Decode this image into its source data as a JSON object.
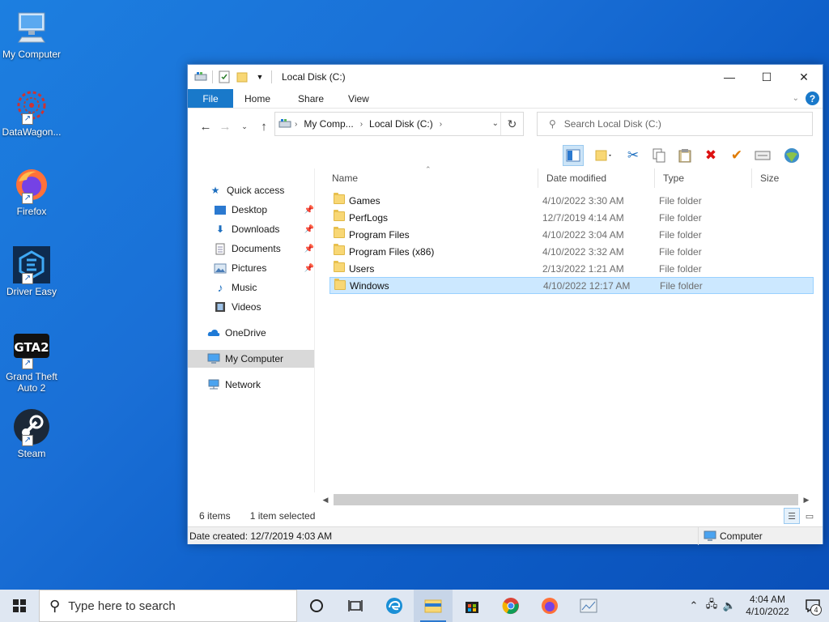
{
  "desktop": {
    "icons": [
      {
        "label": "My Computer"
      },
      {
        "label": "DataWagon..."
      },
      {
        "label": "Firefox"
      },
      {
        "label": "Driver Easy"
      },
      {
        "label": "Grand Theft Auto 2"
      },
      {
        "label": "Steam"
      }
    ],
    "gta_logo_text": "GTA2"
  },
  "window": {
    "title": "Local Disk (C:)",
    "controls": {
      "minimize": "—",
      "maximize": "☐",
      "close": "✕"
    },
    "ribbon": {
      "tabs": [
        "File",
        "Home",
        "Share",
        "View"
      ],
      "help": "?"
    },
    "address": {
      "crumbs": [
        "My Comp...",
        "Local Disk (C:)"
      ],
      "refresh": "↻"
    },
    "search": {
      "placeholder": "Search Local Disk (C:)"
    },
    "navpane": {
      "quick_access": "Quick access",
      "items": [
        "Desktop",
        "Downloads",
        "Documents",
        "Pictures",
        "Music",
        "Videos"
      ],
      "onedrive": "OneDrive",
      "my_computer": "My Computer",
      "network": "Network"
    },
    "columns": {
      "name": "Name",
      "date": "Date modified",
      "type": "Type",
      "size": "Size"
    },
    "files": [
      {
        "name": "Games",
        "date": "4/10/2022 3:30 AM",
        "type": "File folder"
      },
      {
        "name": "PerfLogs",
        "date": "12/7/2019 4:14 AM",
        "type": "File folder"
      },
      {
        "name": "Program Files",
        "date": "4/10/2022 3:04 AM",
        "type": "File folder"
      },
      {
        "name": "Program Files (x86)",
        "date": "4/10/2022 3:32 AM",
        "type": "File folder"
      },
      {
        "name": "Users",
        "date": "2/13/2022 1:21 AM",
        "type": "File folder"
      },
      {
        "name": "Windows",
        "date": "4/10/2022 12:17 AM",
        "type": "File folder",
        "selected": true
      }
    ],
    "status": {
      "count": "6 items",
      "selection": "1 item selected"
    },
    "details": {
      "created": "Date created: 12/7/2019 4:03 AM",
      "location": "Computer"
    }
  },
  "taskbar": {
    "search_placeholder": "Type here to search",
    "clock_time": "4:04 AM",
    "clock_date": "4/10/2022",
    "notification_count": "4"
  },
  "colors": {
    "desktop_bg": "#1a6fd6",
    "accent": "#1979ca",
    "selection": "#cce8ff"
  }
}
